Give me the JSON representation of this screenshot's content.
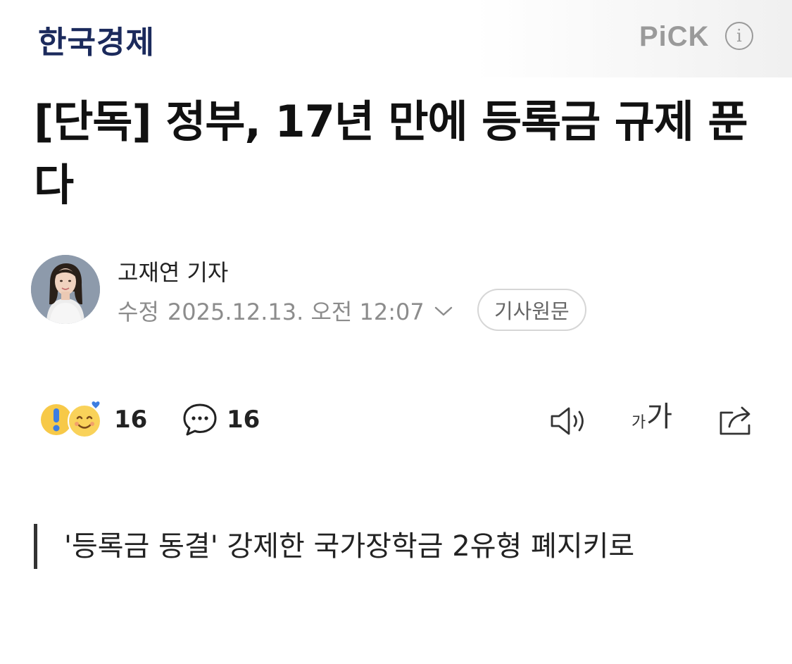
{
  "header": {
    "publisher": "한국경제",
    "pick_label": "PiCK",
    "info_icon": "info-circle-icon"
  },
  "article": {
    "headline": "[단독] 정부, 17년 만에 등록금 규제 푼다",
    "author": "고재연 기자",
    "modified_label": "수정",
    "modified_date": "2025.12.13. 오전 12:07",
    "source_button": "기사원문"
  },
  "actions": {
    "reaction_count": "16",
    "comment_count": "16",
    "font_small": "가",
    "font_large": "가"
  },
  "summary": {
    "text": "'등록금 동결' 강제한 국가장학금 2유형 폐지키로"
  },
  "colors": {
    "brand": "#1b2a5c",
    "muted": "#8c8c8c",
    "reaction_yellow": "#f7c948",
    "reaction_blue": "#3d7de0"
  }
}
